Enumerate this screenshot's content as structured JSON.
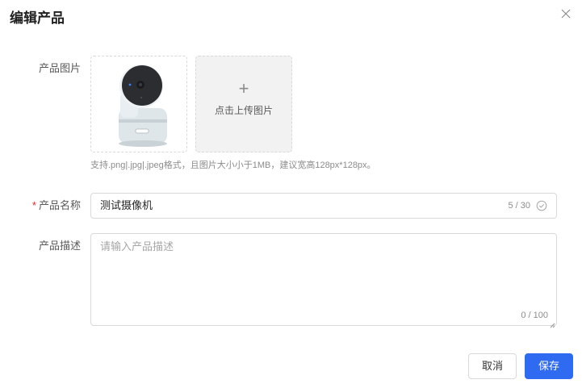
{
  "dialog": {
    "title": "编辑产品"
  },
  "form": {
    "image_label": "产品图片",
    "upload_text": "点击上传图片",
    "upload_plus": "+",
    "image_hint": "支持.png|.jpg|.jpeg格式，且图片大小小于1MB，建议宽高128px*128px。",
    "name_required_mark": "*",
    "name_label": "产品名称",
    "name_value": "测试摄像机",
    "name_count": "5 / 30",
    "desc_label": "产品描述",
    "desc_placeholder": "请输入产品描述",
    "desc_count": "0 / 100"
  },
  "footer": {
    "cancel_label": "取消",
    "save_label": "保存"
  },
  "colors": {
    "primary": "#2f6bf0",
    "required": "#f5222d"
  },
  "icons": {
    "close": "close-icon",
    "check": "check-circle-icon",
    "plus": "plus-icon"
  }
}
